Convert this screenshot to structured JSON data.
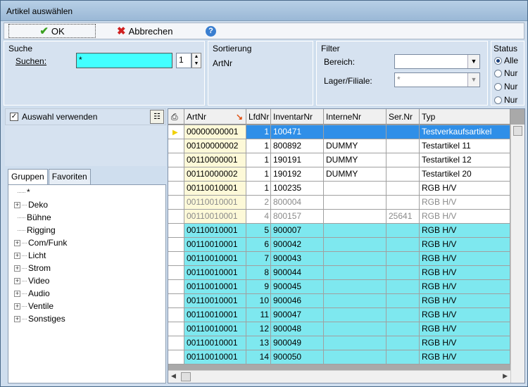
{
  "window": {
    "title": "Artikel auswählen"
  },
  "toolbar": {
    "ok_label": "OK",
    "cancel_label": "Abbrechen"
  },
  "suche": {
    "title": "Suche",
    "label": "Suchen:",
    "value": "*",
    "spin_value": "1"
  },
  "sortierung": {
    "title": "Sortierung",
    "value": "ArtNr"
  },
  "filter": {
    "title": "Filter",
    "bereich_label": "Bereich:",
    "bereich_value": "",
    "lager_label": "Lager/Filiale:",
    "lager_value": "*"
  },
  "status": {
    "title": "Status",
    "options": [
      "Alle",
      "Nur",
      "Nur",
      "Nur"
    ]
  },
  "left": {
    "use_selection_label": "Auswahl verwenden",
    "tabs": [
      "Gruppen",
      "Favoriten"
    ],
    "tree": [
      "*",
      "Deko",
      "Bühne",
      "Rigging",
      "Com/Funk",
      "Licht",
      "Strom",
      "Video",
      "Audio",
      "Ventile",
      "Sonstiges"
    ]
  },
  "grid": {
    "columns": [
      "ArtNr",
      "LfdNr",
      "InventarNr",
      "InterneNr",
      "Ser.Nr",
      "Typ"
    ],
    "rows": [
      {
        "artnr": "00000000001",
        "lfdnr": "1",
        "inventar": "100471",
        "intern": "",
        "sernr": "",
        "typ": "Testverkaufsartikel"
      },
      {
        "artnr": "00100000002",
        "lfdnr": "1",
        "inventar": "800892",
        "intern": "DUMMY",
        "sernr": "",
        "typ": "Testartikel 11"
      },
      {
        "artnr": "00110000001",
        "lfdnr": "1",
        "inventar": "190191",
        "intern": "DUMMY",
        "sernr": "",
        "typ": "Testartikel 12"
      },
      {
        "artnr": "00110000002",
        "lfdnr": "1",
        "inventar": "190192",
        "intern": "DUMMY",
        "sernr": "",
        "typ": "Testartikel 20"
      },
      {
        "artnr": "00110010001",
        "lfdnr": "1",
        "inventar": "100235",
        "intern": "",
        "sernr": "",
        "typ": "RGB H/V"
      },
      {
        "artnr": "00110010001",
        "lfdnr": "2",
        "inventar": "800004",
        "intern": "",
        "sernr": "",
        "typ": "RGB H/V"
      },
      {
        "artnr": "00110010001",
        "lfdnr": "4",
        "inventar": "800157",
        "intern": "",
        "sernr": "25641",
        "typ": "RGB H/V"
      },
      {
        "artnr": "00110010001",
        "lfdnr": "5",
        "inventar": "900007",
        "intern": "",
        "sernr": "",
        "typ": "RGB H/V"
      },
      {
        "artnr": "00110010001",
        "lfdnr": "6",
        "inventar": "900042",
        "intern": "",
        "sernr": "",
        "typ": "RGB H/V"
      },
      {
        "artnr": "00110010001",
        "lfdnr": "7",
        "inventar": "900043",
        "intern": "",
        "sernr": "",
        "typ": "RGB H/V"
      },
      {
        "artnr": "00110010001",
        "lfdnr": "8",
        "inventar": "900044",
        "intern": "",
        "sernr": "",
        "typ": "RGB H/V"
      },
      {
        "artnr": "00110010001",
        "lfdnr": "9",
        "inventar": "900045",
        "intern": "",
        "sernr": "",
        "typ": "RGB H/V"
      },
      {
        "artnr": "00110010001",
        "lfdnr": "10",
        "inventar": "900046",
        "intern": "",
        "sernr": "",
        "typ": "RGB H/V"
      },
      {
        "artnr": "00110010001",
        "lfdnr": "11",
        "inventar": "900047",
        "intern": "",
        "sernr": "",
        "typ": "RGB H/V"
      },
      {
        "artnr": "00110010001",
        "lfdnr": "12",
        "inventar": "900048",
        "intern": "",
        "sernr": "",
        "typ": "RGB H/V"
      },
      {
        "artnr": "00110010001",
        "lfdnr": "13",
        "inventar": "900049",
        "intern": "",
        "sernr": "",
        "typ": "RGB H/V"
      },
      {
        "artnr": "00110010001",
        "lfdnr": "14",
        "inventar": "900050",
        "intern": "",
        "sernr": "",
        "typ": "RGB H/V"
      }
    ]
  },
  "colors": {
    "selected": "#2f8fe8",
    "cyan": "#7ee8ef",
    "artnr_bg": "#fdf9d8",
    "gray_text": "#8a8a8a"
  }
}
